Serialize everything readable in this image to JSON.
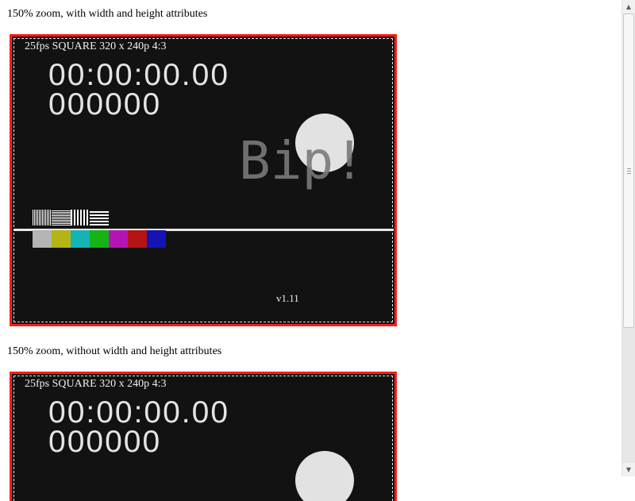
{
  "captions": {
    "first": "150% zoom, with width and height attributes",
    "second": "150% zoom, without width and height attributes"
  },
  "video": {
    "info": "25fps SQUARE 320 x 240p 4:3",
    "timecode": "00:00:00.00",
    "framecount": "000000",
    "bip": "Bip!",
    "version": "v1.11"
  },
  "colors": {
    "border": "#ff1a1a",
    "background": "#121212",
    "colorbars": [
      "#b4b4b4",
      "#b4b414",
      "#14b4b4",
      "#14b414",
      "#b414b4",
      "#b41414",
      "#1414b4"
    ]
  },
  "icons": {
    "scroll_up": "triangle-up",
    "scroll_down": "triangle-down",
    "scroll_grip": "grip-lines"
  },
  "scrollbar": {
    "arrow_up": "▲",
    "arrow_down": "▼"
  }
}
